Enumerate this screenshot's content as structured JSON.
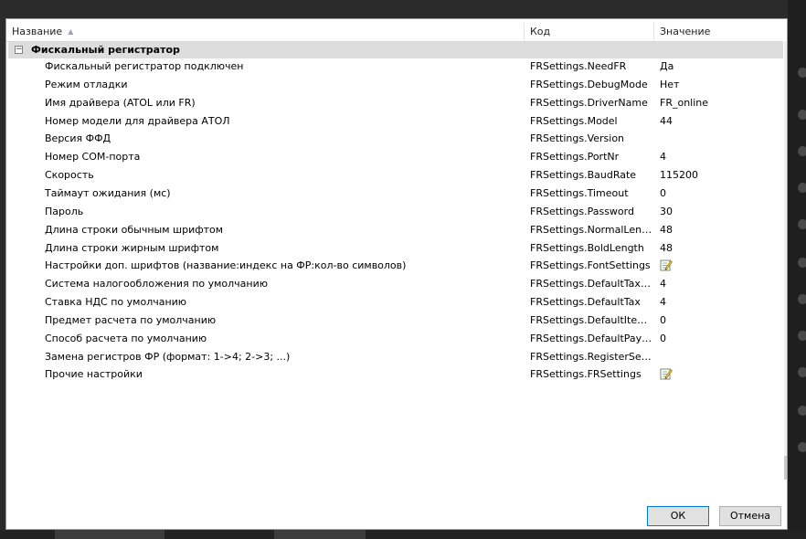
{
  "columns": {
    "name": "Название",
    "code": "Код",
    "value": "Значение"
  },
  "group": {
    "title": "Фискальный регистратор",
    "toggle": "−"
  },
  "rows": [
    {
      "name": "Фискальный регистратор подключен",
      "code": "FRSettings.NeedFR",
      "value": "Да"
    },
    {
      "name": "Режим отладки",
      "code": "FRSettings.DebugMode",
      "value": "Нет"
    },
    {
      "name": "Имя драйвера (ATOL или FR)",
      "code": "FRSettings.DriverName",
      "value": "FR_online"
    },
    {
      "name": "Номер модели для драйвера АТОЛ",
      "code": "FRSettings.Model",
      "value": "44"
    },
    {
      "name": "Версия ФФД",
      "code": "FRSettings.Version",
      "value": ""
    },
    {
      "name": "Номер COM-порта",
      "code": "FRSettings.PortNr",
      "value": "4"
    },
    {
      "name": "Скорость",
      "code": "FRSettings.BaudRate",
      "value": "115200"
    },
    {
      "name": "Таймаут ожидания (мс)",
      "code": "FRSettings.Timeout",
      "value": "0"
    },
    {
      "name": "Пароль",
      "code": "FRSettings.Password",
      "value": "30"
    },
    {
      "name": "Длина строки обычным шрифтом",
      "code": "FRSettings.NormalLength",
      "value": "48"
    },
    {
      "name": "Длина строки жирным шрифтом",
      "code": "FRSettings.BoldLength",
      "value": "48"
    },
    {
      "name": "Настройки доп. шрифтов (название:индекс на ФР:кол-во символов)",
      "code": "FRSettings.FontSettings",
      "value": "",
      "icon": "edit-icon"
    },
    {
      "name": "Система налогообложения по умолчанию",
      "code": "FRSettings.DefaultTaxMode",
      "value": "4"
    },
    {
      "name": "Ставка НДС по умолчанию",
      "code": "FRSettings.DefaultTax",
      "value": "4"
    },
    {
      "name": "Предмет расчета по умолчанию",
      "code": "FRSettings.DefaultItemType",
      "value": "0"
    },
    {
      "name": "Способ расчета по умолчанию",
      "code": "FRSettings.DefaultPayme...",
      "value": "0"
    },
    {
      "name": "Замена регистров ФР (формат: 1->4; 2->3; ...)",
      "code": "FRSettings.RegisterSettings",
      "value": ""
    },
    {
      "name": "Прочие настройки",
      "code": "FRSettings.FRSettings",
      "value": "",
      "icon": "edit-icon"
    }
  ],
  "buttons": {
    "ok": "ОК",
    "cancel": "Отмена"
  }
}
